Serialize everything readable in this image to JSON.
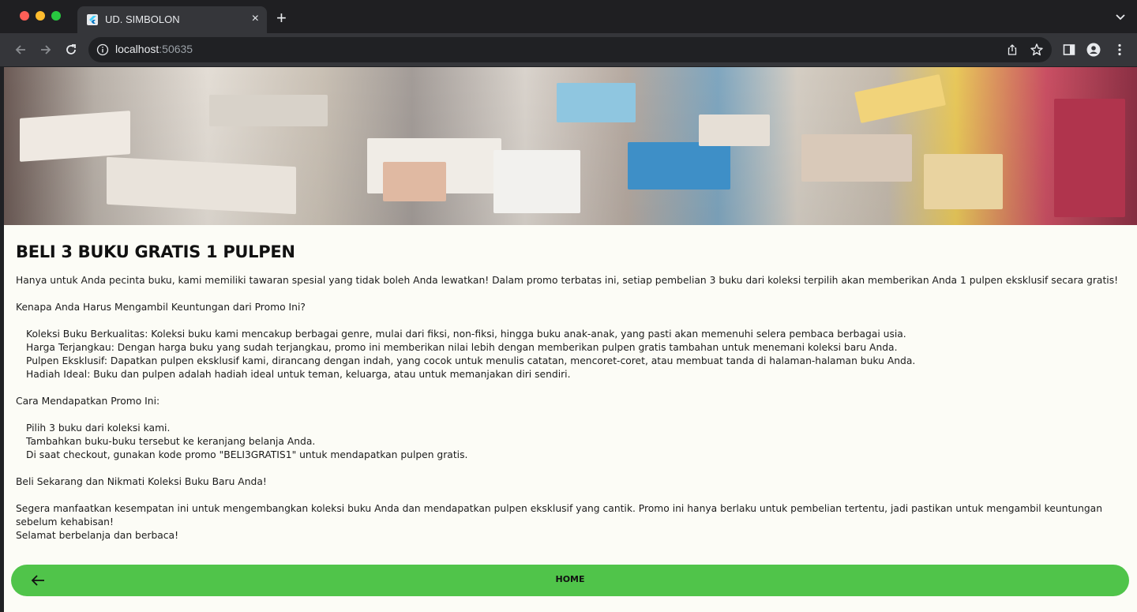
{
  "browser": {
    "tab_title": "UD. SIMBOLON",
    "url_host": "localhost",
    "url_port": ":50635"
  },
  "page": {
    "title": "BELI 3 BUKU GRATIS 1 PULPEN",
    "intro": "Hanya untuk Anda pecinta buku, kami memiliki tawaran spesial yang tidak boleh Anda lewatkan! Dalam promo terbatas ini, setiap pembelian 3 buku dari koleksi terpilih akan memberikan Anda 1 pulpen eksklusif secara gratis!",
    "why_heading": "Kenapa Anda Harus Mengambil Keuntungan dari Promo Ini?",
    "why_items": [
      "Koleksi Buku Berkualitas: Koleksi buku kami mencakup berbagai genre, mulai dari fiksi, non-fiksi, hingga buku anak-anak, yang pasti akan memenuhi selera pembaca berbagai usia.",
      "Harga Terjangkau: Dengan harga buku yang sudah terjangkau, promo ini memberikan nilai lebih dengan memberikan pulpen gratis tambahan untuk menemani koleksi baru Anda.",
      "Pulpen Eksklusif: Dapatkan pulpen eksklusif kami, dirancang dengan indah, yang cocok untuk menulis catatan, mencoret-coret, atau membuat tanda di halaman-halaman buku Anda.",
      "Hadiah Ideal: Buku dan pulpen adalah hadiah ideal untuk teman, keluarga, atau untuk memanjakan diri sendiri."
    ],
    "how_heading": "Cara Mendapatkan Promo Ini:",
    "how_items": [
      "Pilih 3 buku dari koleksi kami.",
      "Tambahkan buku-buku tersebut ke keranjang belanja Anda.",
      "Di saat checkout, gunakan kode promo \"BELI3GRATIS1\" untuk mendapatkan pulpen gratis."
    ],
    "cta": "Beli Sekarang dan Nikmati Koleksi Buku Baru Anda!",
    "closing_1": "Segera manfaatkan kesempatan ini untuk mengembangkan koleksi buku Anda dan mendapatkan pulpen eksklusif yang cantik. Promo ini hanya berlaku untuk pembelian tertentu, jadi pastikan untuk mengambil keuntungan sebelum kehabisan!",
    "closing_2": "Selamat berbelanja dan berbaca!",
    "home_label": "HOME"
  },
  "colors": {
    "home_bar": "#50c44a",
    "page_bg": "#fcfcf6"
  }
}
